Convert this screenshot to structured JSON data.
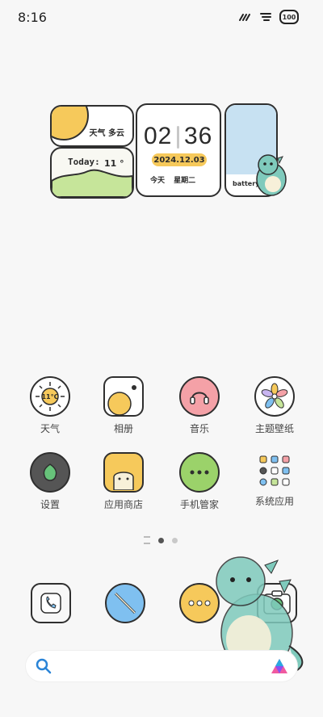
{
  "status": {
    "time": "8:16",
    "battery": "100"
  },
  "widgets": {
    "weather": {
      "condition": "天气 多云",
      "today_label": "Today:",
      "temp": "11 °"
    },
    "clock": {
      "hour": "02",
      "minute": "36",
      "date": "2024.12.03",
      "day_label": "今天",
      "weekday": "星期二"
    },
    "battery": {
      "label": "battery"
    }
  },
  "apps": {
    "row1": [
      {
        "label": "天气"
      },
      {
        "label": "相册"
      },
      {
        "label": "音乐"
      },
      {
        "label": "主题壁纸"
      }
    ],
    "row2": [
      {
        "label": "设置"
      },
      {
        "label": "应用商店"
      },
      {
        "label": "手机管家"
      },
      {
        "label": "系统应用"
      }
    ]
  },
  "weather_icon_text": "11°C",
  "colors": {
    "yellow": "#f6c95b",
    "green": "#c6e59a",
    "blue": "#7fc0f0",
    "pink": "#f4a1a7",
    "teal": "#7fcabc",
    "dark": "#2f2f2f"
  }
}
